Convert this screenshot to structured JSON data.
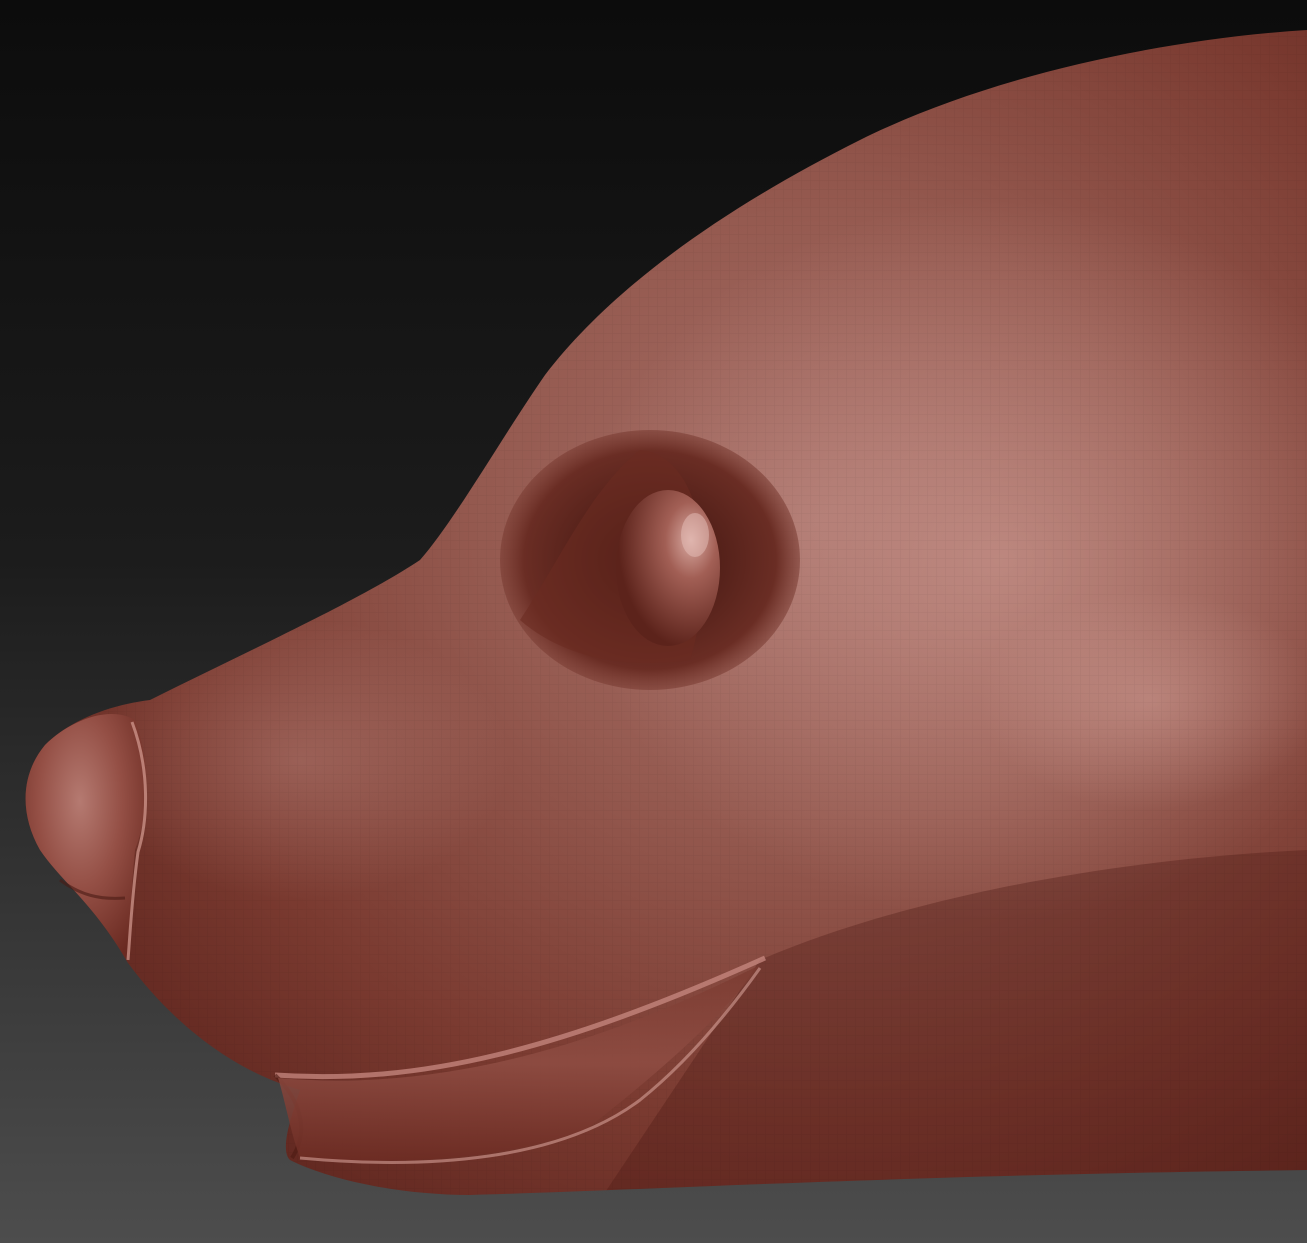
{
  "scene": {
    "background_top": "#0d0d0d",
    "background_bottom": "#4a4a4a",
    "clay_base": "#9a4a3e",
    "clay_dark": "#5e241c",
    "clay_light": "#c98a80",
    "clay_highlight": "#e0b6ae"
  },
  "icons": {
    "model": "sculpted-seal-head-icon"
  }
}
